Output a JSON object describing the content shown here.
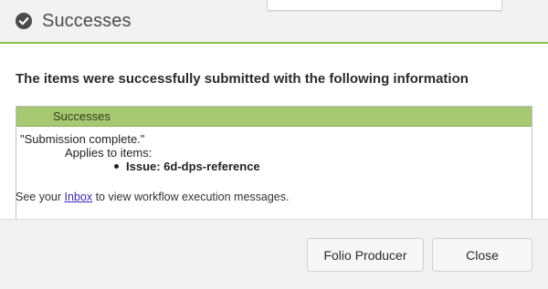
{
  "dialog": {
    "title": "Successes",
    "icon": "check-circle-icon",
    "accent_color": "#8bc34a",
    "intro": "The items were successfully submitted with the following information",
    "table": {
      "header": "Successes",
      "header_color": "#a7c872",
      "message": "\"Submission complete.\"",
      "applies_label": "Applies to items:",
      "items": [
        "Issue: 6d-dps-reference"
      ]
    },
    "inbox_note": {
      "prefix": "See your ",
      "link": "Inbox",
      "suffix": " to view workflow execution messages."
    },
    "buttons": {
      "folio_producer": "Folio Producer",
      "close": "Close"
    }
  }
}
